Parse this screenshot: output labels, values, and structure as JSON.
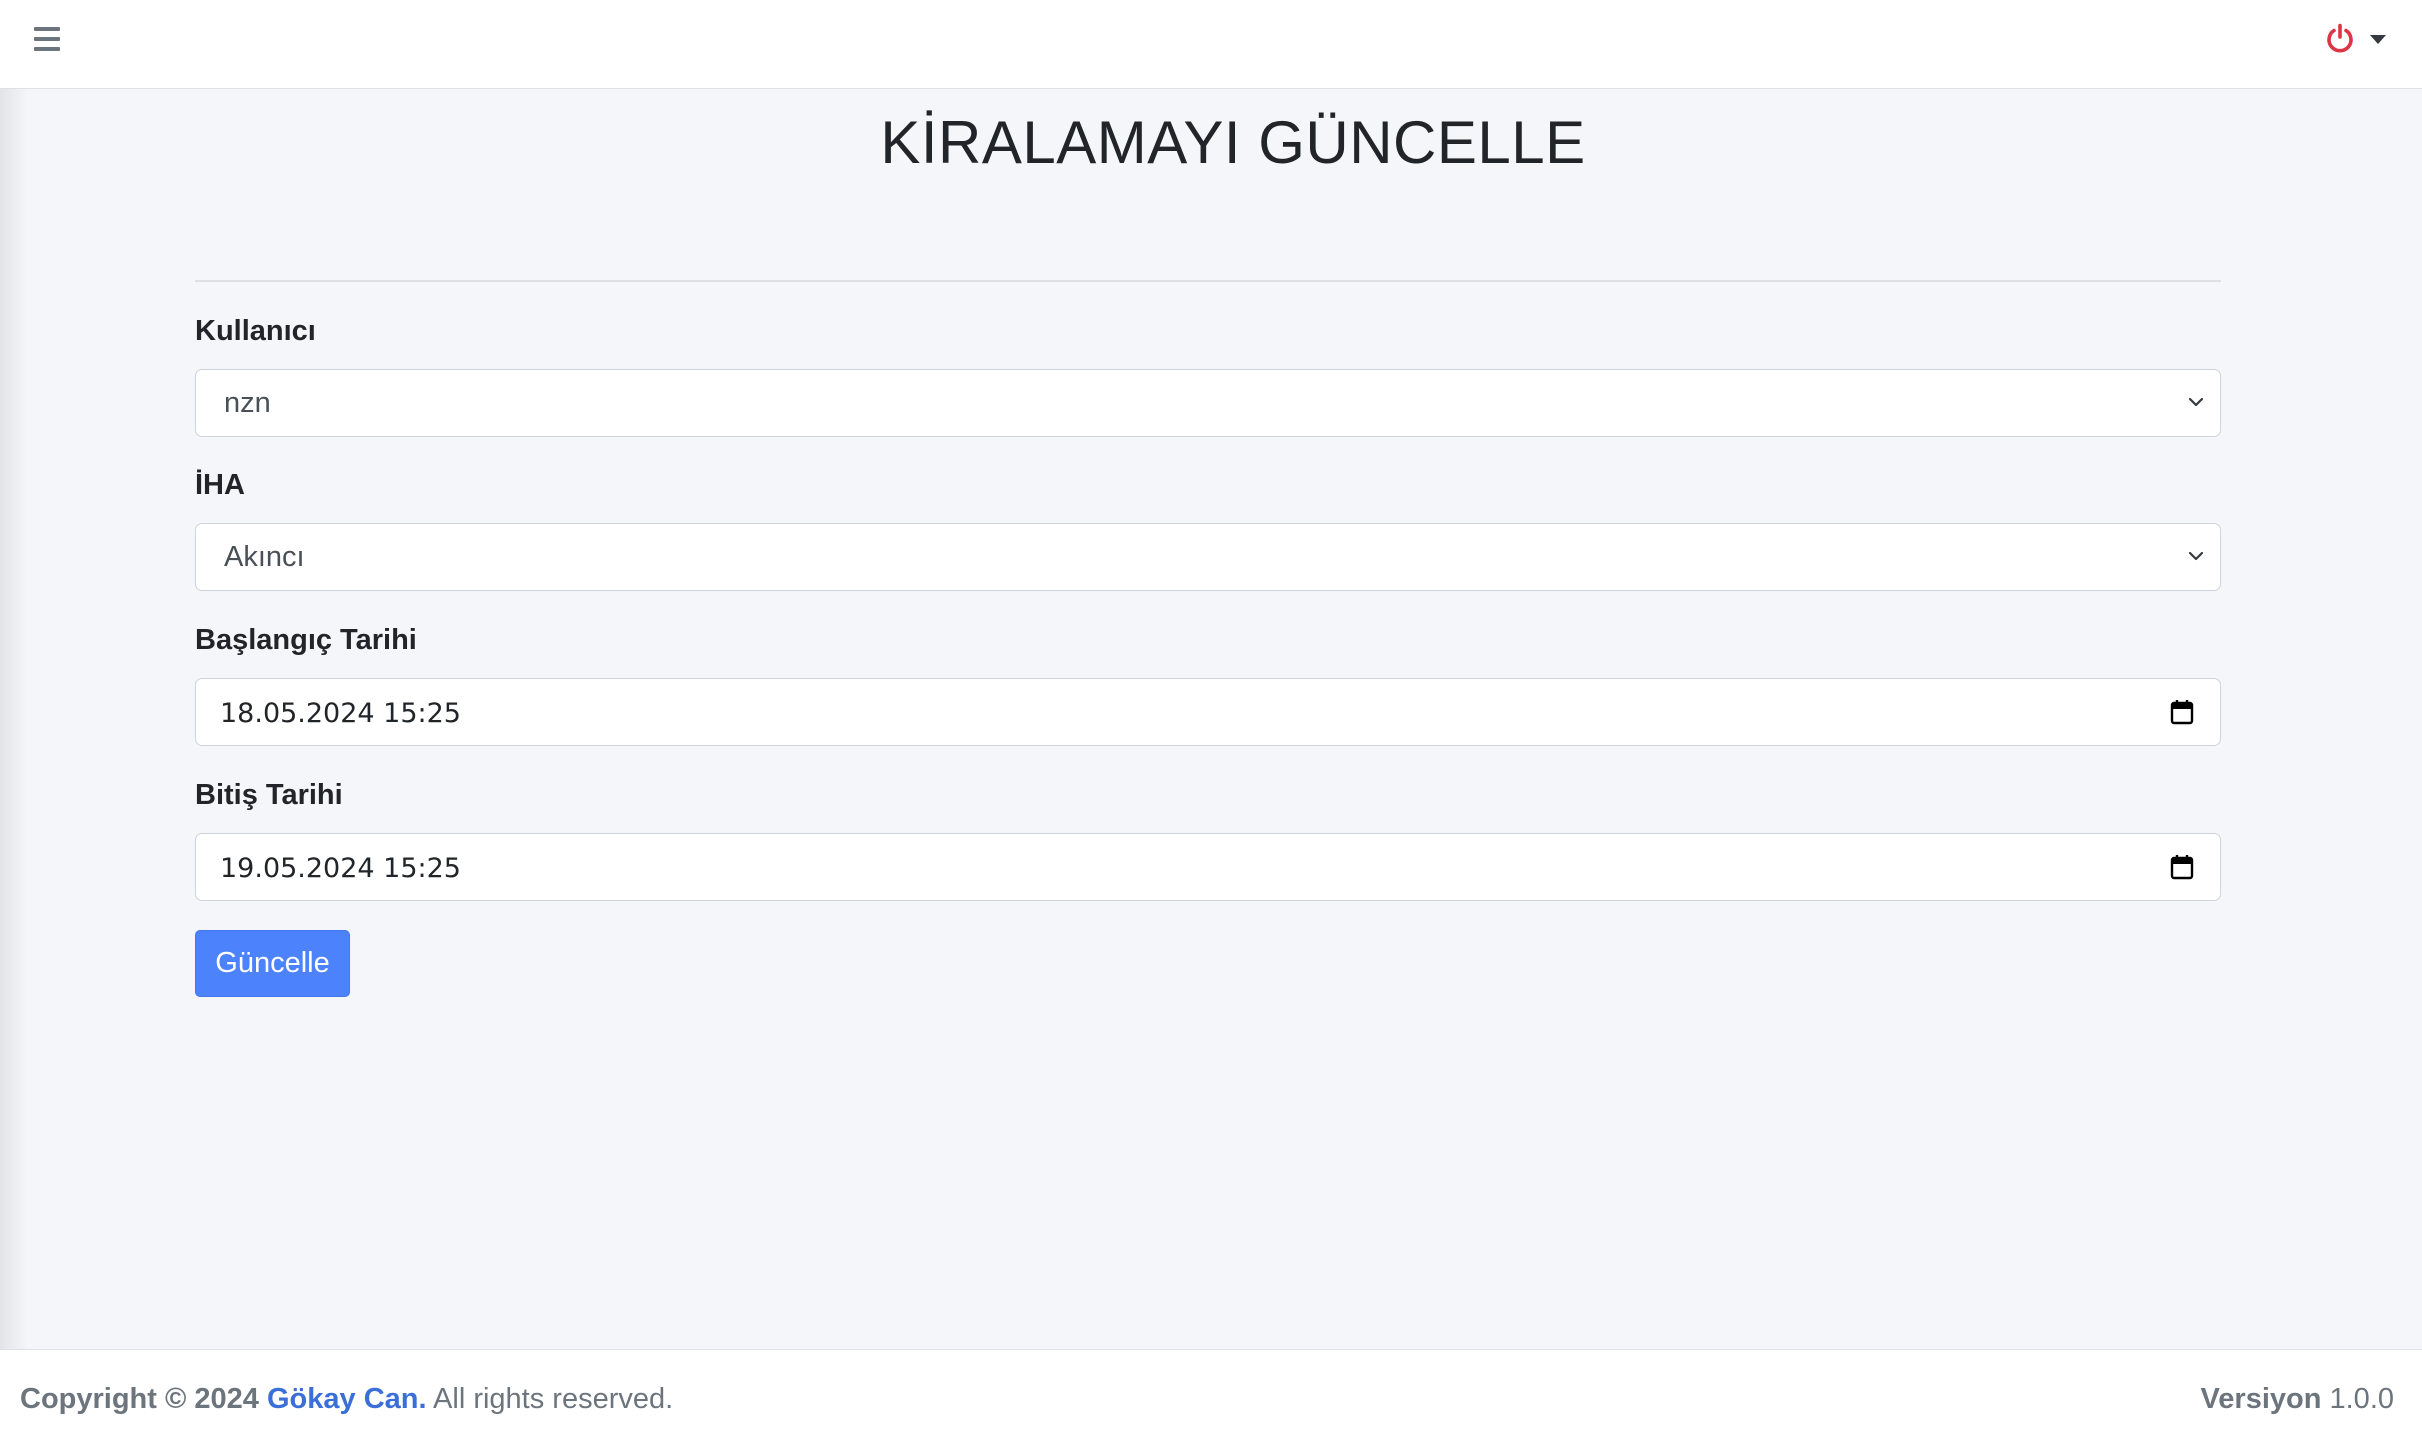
{
  "page": {
    "title": "KİRALAMAYI GÜNCELLE"
  },
  "navbar": {
    "menu_icon": "hamburger-icon",
    "power_icon": "power-icon",
    "power_color": "#dc3545"
  },
  "form": {
    "user_label": "Kullanıcı",
    "user_value": "nzn",
    "uav_label": "İHA",
    "uav_value": "Akıncı",
    "start_label": "Başlangıç Tarihi",
    "start_value": "18.05.2024  15:25",
    "end_label": "Bitiş Tarihi",
    "end_value": "19.05.2024  15:25",
    "submit_label": "Güncelle",
    "accent_color": "#4c82fb"
  },
  "footer": {
    "copyright": "Copyright © 2024",
    "author": "Gökay Can.",
    "rights": "All rights reserved.",
    "version_label": "Versiyon",
    "version_value": "1.0.0"
  }
}
